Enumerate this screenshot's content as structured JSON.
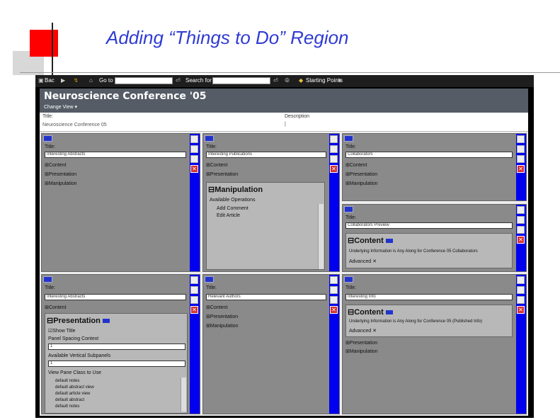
{
  "slide": {
    "title": "Adding “Things to Do” Region"
  },
  "toolbar": {
    "back": "Bac",
    "goto": "Go to",
    "search": "Search for",
    "starting_points": "Starting Points"
  },
  "page": {
    "title": "Neuroscience Conference '05",
    "change_view": "Change View",
    "title_label": "Title:",
    "title_value": "Neuroscience Conference 05",
    "description_label": "Description"
  },
  "panels": [
    {
      "title_label": "Title:",
      "title_value": "Interesting Abstracts",
      "items": [
        "Content",
        "Presentation",
        "Manipulation"
      ]
    },
    {
      "title_label": "Title:",
      "title_value": "Interesting Publications",
      "items": [
        "Content",
        "Presentation"
      ],
      "sub_heading": "Manipulation",
      "sub_label": "Available Operations",
      "sub_items": [
        "Add Comment",
        "Edit Article"
      ]
    },
    {
      "title_label": "Title:",
      "title_value": "Collaborators",
      "items": [
        "Content",
        "Presentation",
        "Manipulation"
      ]
    },
    {
      "title_label": "Title:",
      "title_value": "Collaborators Preview",
      "sub_heading": "Content",
      "sub_line": "Underlying Information is Any Along for Conference 05 Collaborators",
      "sub_extra": "Advanced"
    },
    {
      "title_label": "Title:",
      "title_value": "Interesting Abstracts",
      "items": [
        "Content"
      ],
      "sub_heading": "Presentation",
      "sub_options": [
        "Show Title",
        "Panel Spacing Context",
        "1",
        "Available Vertical Subpanels",
        "1",
        "View Pane Class to Use"
      ],
      "sub_rows": [
        "default notes",
        "default abstract view",
        "default article view",
        "default abstract",
        "default notes"
      ]
    },
    {
      "title_label": "Title:",
      "title_value": "Relevant Authors",
      "items": [
        "Content",
        "Presentation",
        "Manipulation"
      ]
    },
    {
      "title_label": "Title:",
      "title_value": "Interesting Info",
      "items": [
        "Presentation",
        "Manipulation"
      ],
      "sub_heading": "Content",
      "sub_line": "Underlying Information is Any Along for Conference 05 (Published Info)",
      "sub_extra": "Advanced"
    }
  ],
  "colors": {
    "accent_blue": "#0000ee",
    "title_blue": "#2f3bd4",
    "header": "#555c66",
    "panel": "#8a8a8a"
  }
}
